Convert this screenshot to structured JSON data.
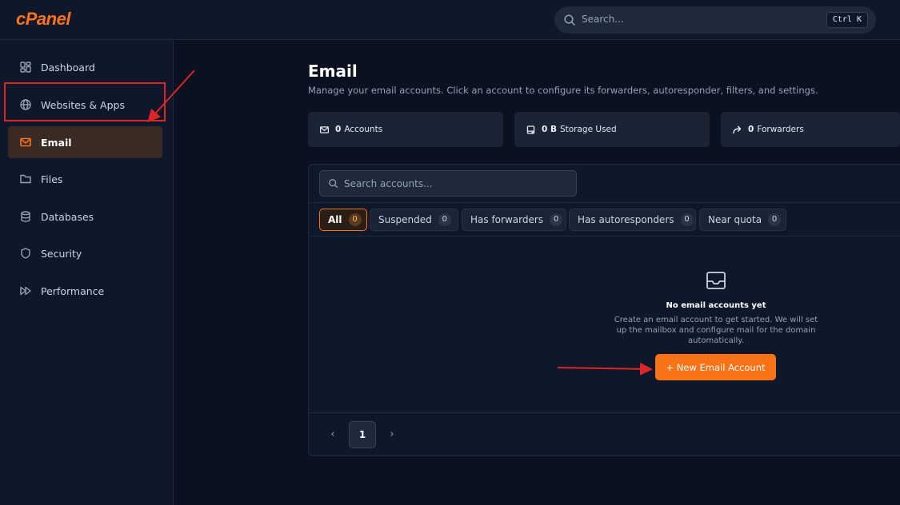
{
  "app": {
    "logo": "cPanel"
  },
  "search": {
    "placeholder": "Search...",
    "shortcut": "Ctrl K"
  },
  "sidebar": {
    "items": [
      {
        "label": "Dashboard",
        "icon": "dashboard-icon"
      },
      {
        "label": "Websites & Apps",
        "icon": "globe-icon"
      },
      {
        "label": "Email",
        "icon": "mail-icon",
        "active": true
      },
      {
        "label": "Files",
        "icon": "folder-icon"
      },
      {
        "label": "Databases",
        "icon": "database-icon"
      },
      {
        "label": "Security",
        "icon": "shield-icon"
      },
      {
        "label": "Performance",
        "icon": "fast-forward-icon"
      }
    ]
  },
  "page": {
    "title": "Email",
    "subtitle": "Manage your email accounts. Click an account to configure its forwarders, autoresponder, filters, and settings."
  },
  "stats": [
    {
      "value": "0",
      "label": "Accounts",
      "icon": "mail-icon"
    },
    {
      "value": "0 B",
      "label": "Storage Used",
      "icon": "hard-drive-icon"
    },
    {
      "value": "0",
      "label": "Forwarders",
      "icon": "forward-icon"
    }
  ],
  "accounts": {
    "search_placeholder": "Search accounts...",
    "filters": [
      {
        "label": "All",
        "count": "0",
        "active": true
      },
      {
        "label": "Suspended",
        "count": "0"
      },
      {
        "label": "Has forwarders",
        "count": "0"
      },
      {
        "label": "Has autoresponders",
        "count": "0"
      },
      {
        "label": "Near quota",
        "count": "0"
      }
    ],
    "empty": {
      "title": "No email accounts yet",
      "description": "Create an email account to get started. We will set up the mailbox and configure mail for the domain automatically.",
      "button": "+ New Email Account",
      "icon": "inbox-icon"
    },
    "pagination": {
      "prev": "‹",
      "current": "1",
      "next": "›"
    }
  },
  "colors": {
    "accent": "#f97316",
    "annotation": "#dc2626",
    "background": "#0b1120",
    "panel": "#0f172a"
  }
}
